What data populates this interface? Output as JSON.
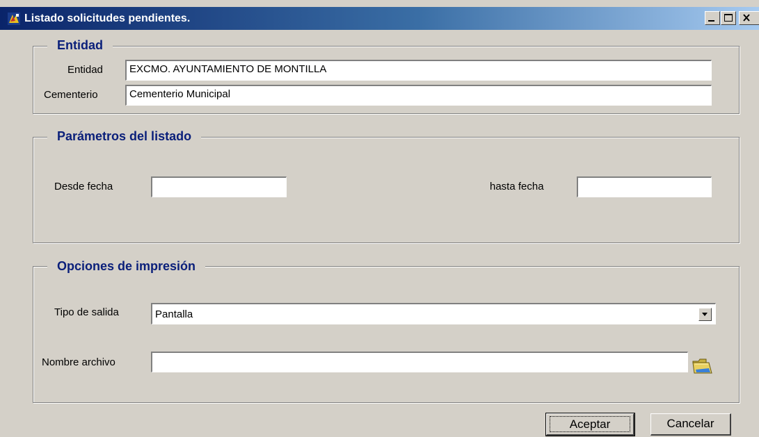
{
  "window": {
    "title": "Listado solicitudes pendientes.",
    "controls": [
      "minimize-icon",
      "maximize-icon",
      "close-icon"
    ],
    "title_gradient": [
      "#0a246a",
      "#a6caf0"
    ],
    "background": "#d4d0c8"
  },
  "entidad_group": {
    "title": "Entidad",
    "entidad_label": "Entidad",
    "entidad_value": "EXCMO. AYUNTAMIENTO DE MONTILLA",
    "cementerio_label": "Cementerio",
    "cementerio_value": "Cementerio Municipal"
  },
  "parametros_group": {
    "title": "Parámetros del listado",
    "desde_label": "Desde fecha",
    "desde_value": "",
    "hasta_label": "hasta fecha",
    "hasta_value": ""
  },
  "opciones_group": {
    "title": "Opciones de impresión",
    "tipo_label": "Tipo de salida",
    "tipo_value": "Pantalla",
    "nombre_label": "Nombre archivo",
    "nombre_value": ""
  },
  "buttons": {
    "aceptar": "Aceptar",
    "cancelar": "Cancelar"
  },
  "group_title_color": "#0a1f7a"
}
